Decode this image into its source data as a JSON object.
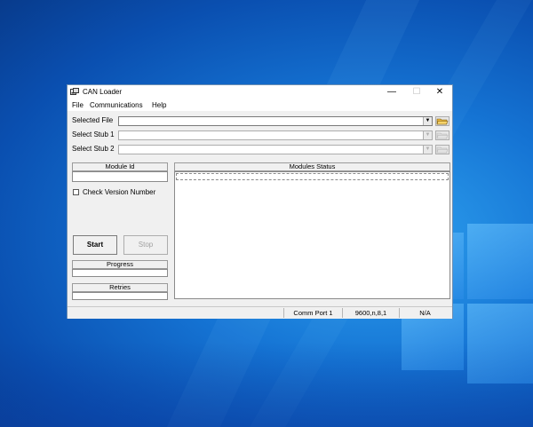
{
  "window": {
    "title": "CAN Loader",
    "minimize": "—",
    "maximize": "☐",
    "close": "✕"
  },
  "menu": {
    "items": [
      "File",
      "Communications",
      "Help"
    ]
  },
  "selectors": {
    "selected_file": {
      "label": "Selected File",
      "value": ""
    },
    "stub1": {
      "label": "Select Stub 1",
      "value": ""
    },
    "stub2": {
      "label": "Select Stub 2",
      "value": ""
    },
    "arrow": "▼"
  },
  "left_panel": {
    "module_id_header": "Module Id",
    "module_id_value": "",
    "check_version_label": "Check Version Number",
    "start_label": "Start",
    "stop_label": "Stop",
    "progress_header": "Progress",
    "retries_header": "Retries"
  },
  "modules_status": {
    "header": "Modules Status"
  },
  "statusbar": {
    "port": "Comm Port 1",
    "settings": "9600,n,8,1",
    "state": "N/A"
  },
  "icons": {
    "app": "can-loader-icon",
    "folder": "folder-open-icon"
  },
  "colors": {
    "desktop_blue": "#1574d4",
    "window_bg": "#f0f0f0",
    "folder_yellow": "#e8b53a"
  }
}
